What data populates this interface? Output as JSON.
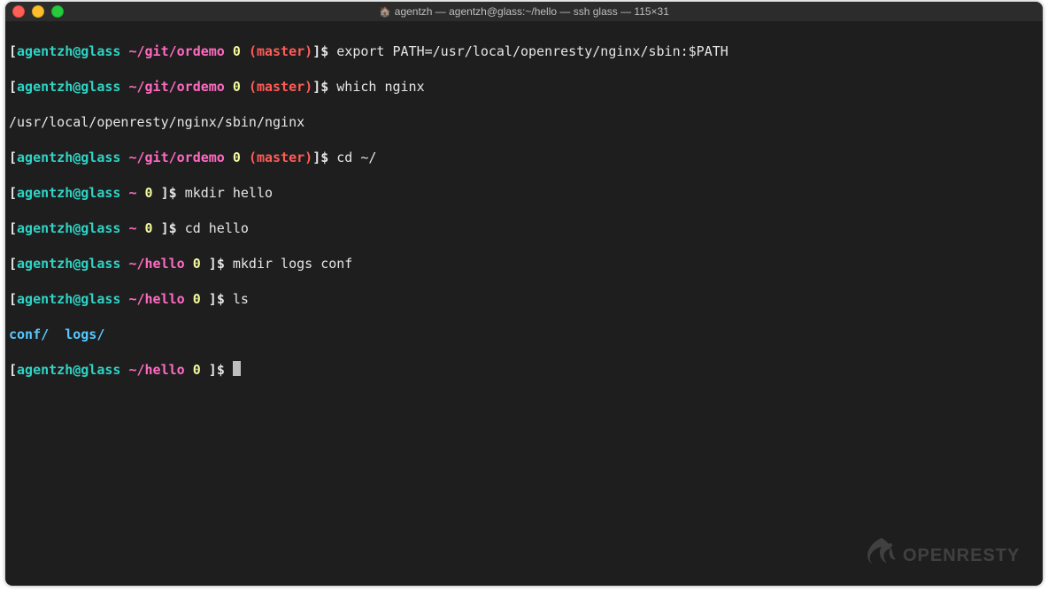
{
  "window": {
    "title": "agentzh — agentzh@glass:~/hello — ssh glass — 115×31"
  },
  "prompt": {
    "user": "agentzh@glass",
    "open": "[",
    "close": "]",
    "dollar": "$",
    "num": "0",
    "branch": "(master)",
    "path_ordemo": "~/git/ordemo",
    "path_home": "~",
    "path_hello": "~/hello"
  },
  "cmd": {
    "l1": "export PATH=/usr/local/openresty/nginx/sbin:$PATH",
    "l2": "which nginx",
    "l2_out": "/usr/local/openresty/nginx/sbin/nginx",
    "l3": "cd ~/",
    "l4": "mkdir hello",
    "l5": "cd hello",
    "l6": "mkdir logs conf",
    "l7": "ls",
    "ls_out_a": "conf/",
    "ls_out_b": "logs/"
  },
  "watermark": {
    "text": "OPENRESTY"
  }
}
